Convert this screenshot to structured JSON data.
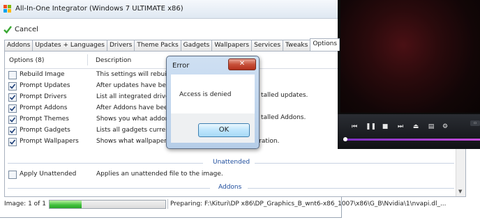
{
  "window": {
    "title": "All-In-One Integrator (Windows 7 ULTIMATE x86)"
  },
  "toolbar": {
    "cancel_label": "Cancel"
  },
  "tabs": [
    "Addons",
    "Updates + Languages",
    "Drivers",
    "Theme Packs",
    "Gadgets",
    "Wallpapers",
    "Services",
    "Tweaks",
    "Options"
  ],
  "active_tab": "Options",
  "columns": {
    "options": "Options (8)",
    "description": "Description"
  },
  "rows": [
    {
      "label": "Rebuild Image",
      "checked": false,
      "desc": "This settings will rebuild th"
    },
    {
      "label": "Prompt Updates",
      "checked": true,
      "desc": "After updates have been"
    },
    {
      "label": "Prompt Drivers",
      "checked": true,
      "desc": "List all integrated drivers a"
    },
    {
      "label": "Prompt Addons",
      "checked": true,
      "desc": "After Addons have been"
    },
    {
      "label": "Prompt Themes",
      "checked": true,
      "desc": "Shows you what addons"
    },
    {
      "label": "Prompt Gadgets",
      "checked": true,
      "desc": "Lists all gadgets currently"
    },
    {
      "label": "Prompt Wallpapers",
      "checked": true,
      "desc": "Shows what wallpapers are installed at end of integration."
    }
  ],
  "desc_tails": {
    "updates": "talled updates.",
    "addons": "talled Addons."
  },
  "groups": {
    "unattended": "Unattended",
    "addons": "Addons"
  },
  "unattended_row": {
    "label": "Apply Unattended",
    "checked": false,
    "desc": "Applies an unattended file to the image."
  },
  "status": {
    "image": "Image: 1 of 1",
    "progress": 0.28,
    "text": "Preparing: F:\\Kituri\\DP x86\\DP_Graphics_B_wnt6-x86_1007\\x86\\G_B\\Nvidia\\1\\nvapi.dl_..."
  },
  "dialog": {
    "title": "Error",
    "message": "Access is denied",
    "ok_label": "OK"
  },
  "colors": {
    "accent": "#1d4c9c",
    "progress": "#3fbf3a",
    "player_seek": "#c34dd8"
  }
}
